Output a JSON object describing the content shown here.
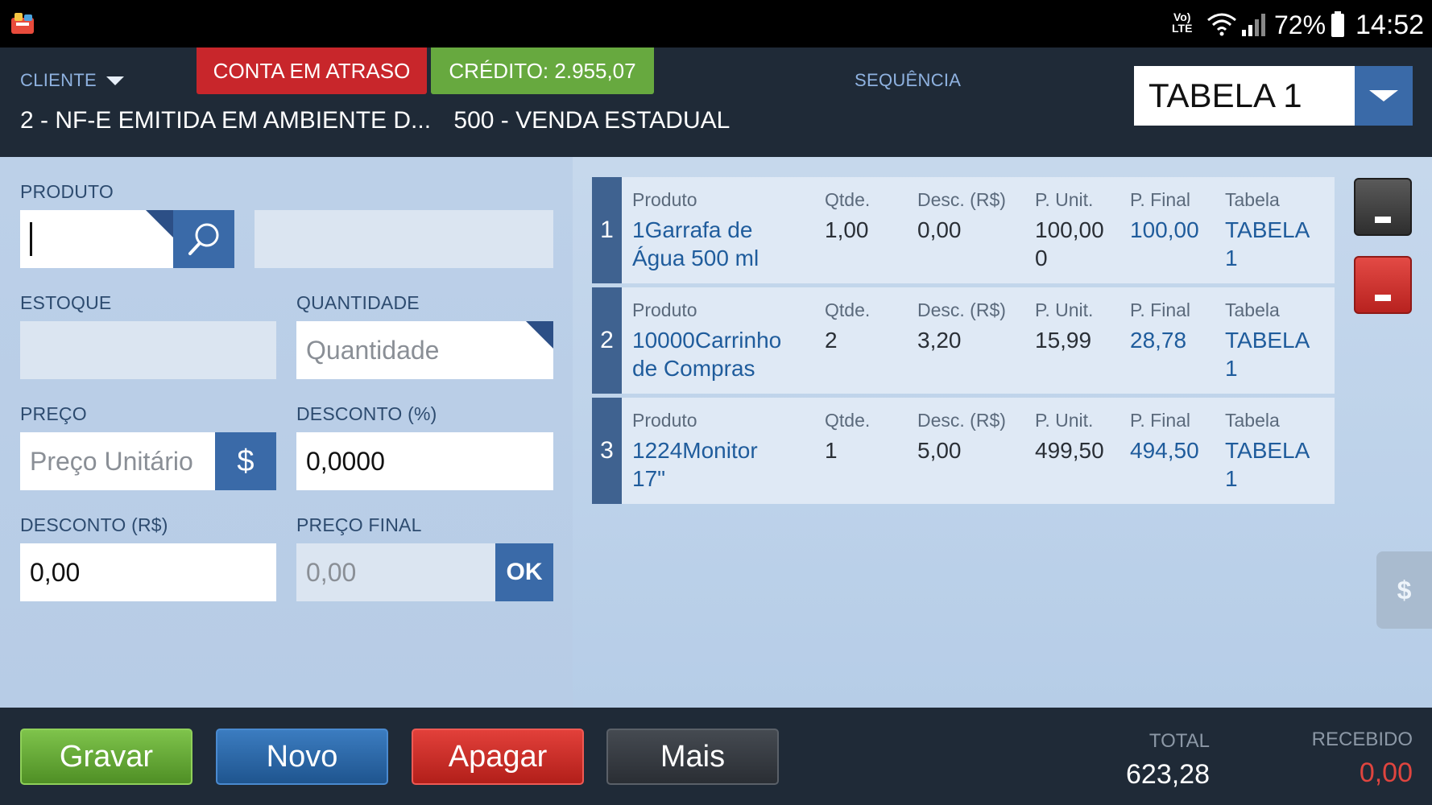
{
  "status_bar": {
    "volte_top": "Vo)",
    "volte_bottom": "LTE",
    "battery": "72%",
    "time": "14:52"
  },
  "header": {
    "cliente_label": "CLIENTE",
    "badge_overdue": "CONTA EM ATRASO",
    "badge_credit": "CRÉDITO:  2.955,07",
    "sequencia_label": "SEQUÊNCIA",
    "info_left": "2 -  NF-E EMITIDA EM AMBIENTE D...",
    "info_right": "500 -  VENDA ESTADUAL",
    "tabela_value": "TABELA 1"
  },
  "form": {
    "produto_label": "PRODUTO",
    "estoque_label": "ESTOQUE",
    "quantidade_label": "QUANTIDADE",
    "quantidade_placeholder": "Quantidade",
    "preco_label": "PREÇO",
    "preco_placeholder": "Preço Unitário",
    "preco_btn": "$",
    "desconto_pct_label": "DESCONTO (%)",
    "desconto_pct_value": "0,0000",
    "desconto_rs_label": "DESCONTO (R$)",
    "desconto_rs_value": "0,00",
    "preco_final_label": "PREÇO FINAL",
    "preco_final_value": "0,00",
    "ok_btn": "OK"
  },
  "items_headers": {
    "produto": "Produto",
    "qtde": "Qtde.",
    "desc": "Desc. (R$)",
    "punit": "P. Unit.",
    "pfinal": "P. Final",
    "tabela": "Tabela"
  },
  "items": [
    {
      "num": "1",
      "produto_l1": "1Garrafa de",
      "produto_l2": "Água 500 ml",
      "qtde": "1,00",
      "desc": "0,00",
      "punit_l1": "100,00",
      "punit_l2": "0",
      "pfinal": "100,00",
      "tabela_l1": "TABELA",
      "tabela_l2": "1"
    },
    {
      "num": "2",
      "produto_l1": "10000Carrinho",
      "produto_l2": "de Compras",
      "qtde": "2",
      "desc": "3,20",
      "punit_l1": "15,99",
      "punit_l2": "",
      "pfinal": "28,78",
      "tabela_l1": "TABELA",
      "tabela_l2": "1"
    },
    {
      "num": "3",
      "produto_l1": "1224Monitor",
      "produto_l2": "17\"",
      "qtde": "1",
      "desc": "5,00",
      "punit_l1": "499,50",
      "punit_l2": "",
      "pfinal": "494,50",
      "tabela_l1": "TABELA",
      "tabela_l2": "1"
    }
  ],
  "side": {
    "pay_tab": "$"
  },
  "footer": {
    "gravar": "Gravar",
    "novo": "Novo",
    "apagar": "Apagar",
    "mais": "Mais",
    "total_label": "TOTAL",
    "total_value": "623,28",
    "recebido_label": "RECEBIDO",
    "recebido_value": "0,00"
  },
  "colors": {
    "header_bg": "#1f2a37",
    "overdue_red": "#c8262b",
    "credit_green": "#67a93f",
    "accent_blue": "#3a6aa8",
    "value_blue": "#1f5c9c",
    "recebido_red": "#e0453f"
  }
}
